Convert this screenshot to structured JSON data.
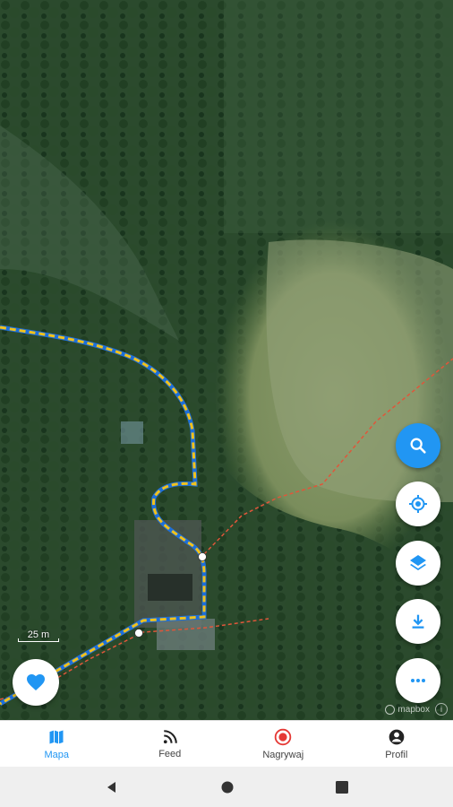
{
  "map": {
    "scale_label": "25 m",
    "attribution": "mapbox",
    "attribution_info": "i",
    "route_colors": {
      "trail_dashed": "#f2c21b",
      "trail_alt": "#1e6fd9",
      "road": "#e0563a"
    }
  },
  "actions": {
    "search": "search-icon",
    "locate": "my-location-icon",
    "layers": "layers-icon",
    "download": "download-icon",
    "more": "more-icon",
    "favorite": "heart-icon"
  },
  "nav": {
    "items": [
      {
        "label": "Mapa",
        "icon": "map-icon",
        "active": true
      },
      {
        "label": "Feed",
        "icon": "feed-icon",
        "active": false
      },
      {
        "label": "Nagrywaj",
        "icon": "record-icon",
        "active": false
      },
      {
        "label": "Profil",
        "icon": "profile-icon",
        "active": false
      }
    ]
  },
  "colors": {
    "accent": "#2196f3",
    "record": "#e53935"
  }
}
